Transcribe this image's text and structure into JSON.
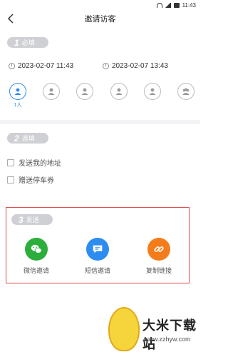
{
  "status": {
    "time": "11:43"
  },
  "header": {
    "title": "邀请访客"
  },
  "section1": {
    "num": "1",
    "label": "必填"
  },
  "times": {
    "start": "2023-02-07 11:43",
    "end": "2023-02-07 13:43"
  },
  "visitors": {
    "selected_label": "1人",
    "count": 6
  },
  "section2": {
    "num": "2",
    "label": "选填"
  },
  "options": [
    {
      "label": "发送我的地址"
    },
    {
      "label": "赠送停车券"
    }
  ],
  "section3": {
    "num": "3",
    "label": "发送"
  },
  "share": [
    {
      "label": "微信邀请",
      "color": "#2bae3c",
      "icon": "wechat-icon"
    },
    {
      "label": "短信邀请",
      "color": "#2d8cf0",
      "icon": "sms-icon"
    },
    {
      "label": "复制链接",
      "color": "#f57c1b",
      "icon": "link-icon"
    }
  ],
  "watermark": {
    "brand": "大米下载站",
    "url": "www.zzhyw.com"
  },
  "colors": {
    "accent": "#2d8cf0",
    "highlight_border": "#e14a4a",
    "tag_bg": "#cfd0d3"
  }
}
